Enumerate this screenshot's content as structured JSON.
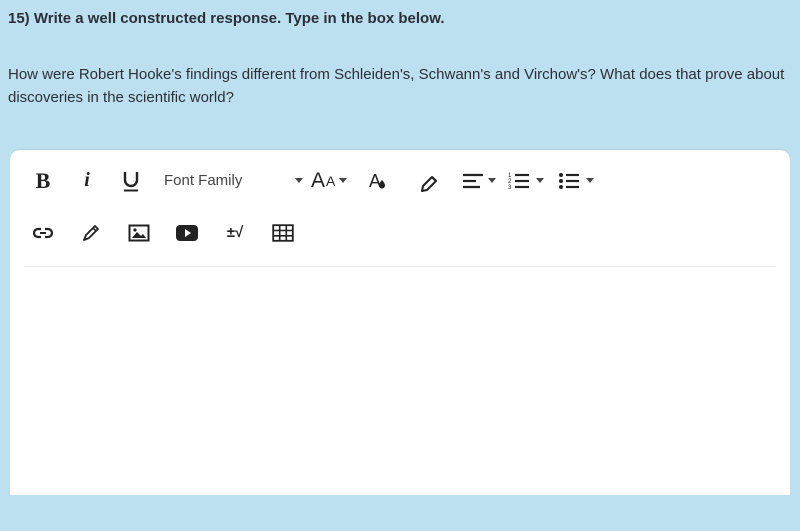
{
  "question": {
    "number_prefix": "15)",
    "instruction": "Write a well constructed response. Type in the box below.",
    "prompt": "How were Robert Hooke's findings different from Schleiden's, Schwann's and Virchow's? What does that prove about discoveries in the scientific world?"
  },
  "editor": {
    "font_family_label": "Font Family",
    "bold_glyph": "B",
    "italic_glyph": "i",
    "font_size_large": "A",
    "font_size_small": "A",
    "math_symbol": "±√"
  }
}
